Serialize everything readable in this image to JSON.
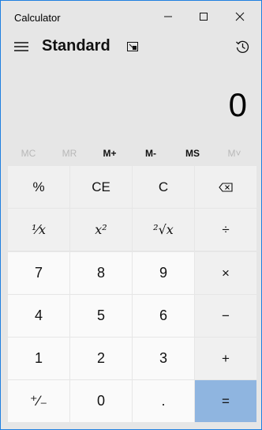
{
  "window": {
    "title": "Calculator"
  },
  "header": {
    "mode": "Standard"
  },
  "display": {
    "value": "0"
  },
  "memory": {
    "buttons": [
      "MC",
      "MR",
      "M+",
      "M-",
      "MS",
      "M˅"
    ]
  },
  "keys": {
    "percent": "%",
    "clear_entry": "CE",
    "clear": "C",
    "reciprocal": "¹⁄x",
    "square": "x²",
    "sqrt": "²√x",
    "divide": "÷",
    "seven": "7",
    "eight": "8",
    "nine": "9",
    "multiply": "×",
    "four": "4",
    "five": "5",
    "six": "6",
    "subtract": "−",
    "one": "1",
    "two": "2",
    "three": "3",
    "add": "+",
    "negate": "⁺∕₋",
    "zero": "0",
    "decimal": ".",
    "equals": "="
  },
  "colors": {
    "accent_border": "#1f7fe0",
    "equals_bg": "#8fb5e0"
  }
}
